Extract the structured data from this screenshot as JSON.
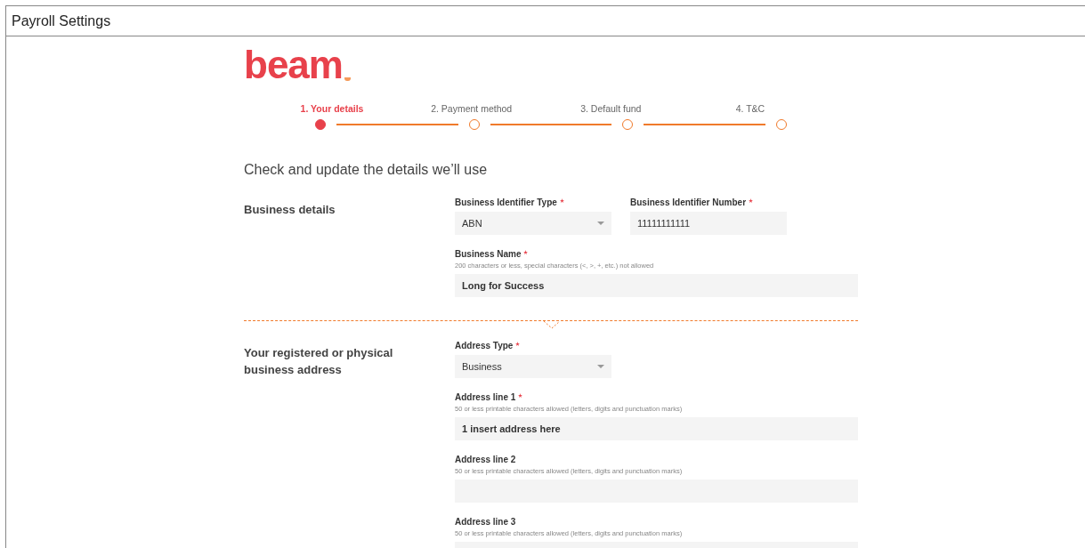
{
  "window": {
    "title": "Payroll Settings"
  },
  "logo": {
    "text": "beam"
  },
  "steps": [
    {
      "label": "1. Your details",
      "selected": true
    },
    {
      "label": "2. Payment method",
      "selected": false
    },
    {
      "label": "3. Default fund",
      "selected": false
    },
    {
      "label": "4. T&C",
      "selected": false
    }
  ],
  "heading": "Check and update the details we’ll use",
  "sections": [
    {
      "title": "Business details",
      "rows": [
        [
          {
            "kind": "select",
            "label": "Business Identifier Type",
            "required": true,
            "value": "ABN"
          },
          {
            "kind": "text",
            "label": "Business Identifier Number",
            "required": true,
            "value": "11111111111"
          }
        ],
        [
          {
            "kind": "text",
            "label": "Business Name",
            "required": true,
            "hint": "200 characters or less, special characters (<, >, +, etc.) not allowed",
            "value": "Long for Success"
          }
        ]
      ]
    },
    {
      "title": "Your registered or physical business address",
      "rows": [
        [
          {
            "kind": "select",
            "label": "Address Type",
            "required": true,
            "value": "Business"
          }
        ],
        [
          {
            "kind": "text",
            "label": "Address line 1",
            "required": true,
            "hint": "50 or less printable characters allowed (letters, digits and punctuation marks)",
            "value": "1 insert address here"
          }
        ],
        [
          {
            "kind": "text",
            "label": "Address line 2",
            "required": false,
            "hint": "50 or less printable characters allowed (letters, digits and punctuation marks)"
          }
        ],
        [
          {
            "kind": "text",
            "label": "Address line 3",
            "required": false,
            "hint": "50 or less printable characters allowed (letters, digits and punctuation marks)"
          }
        ]
      ]
    }
  ]
}
